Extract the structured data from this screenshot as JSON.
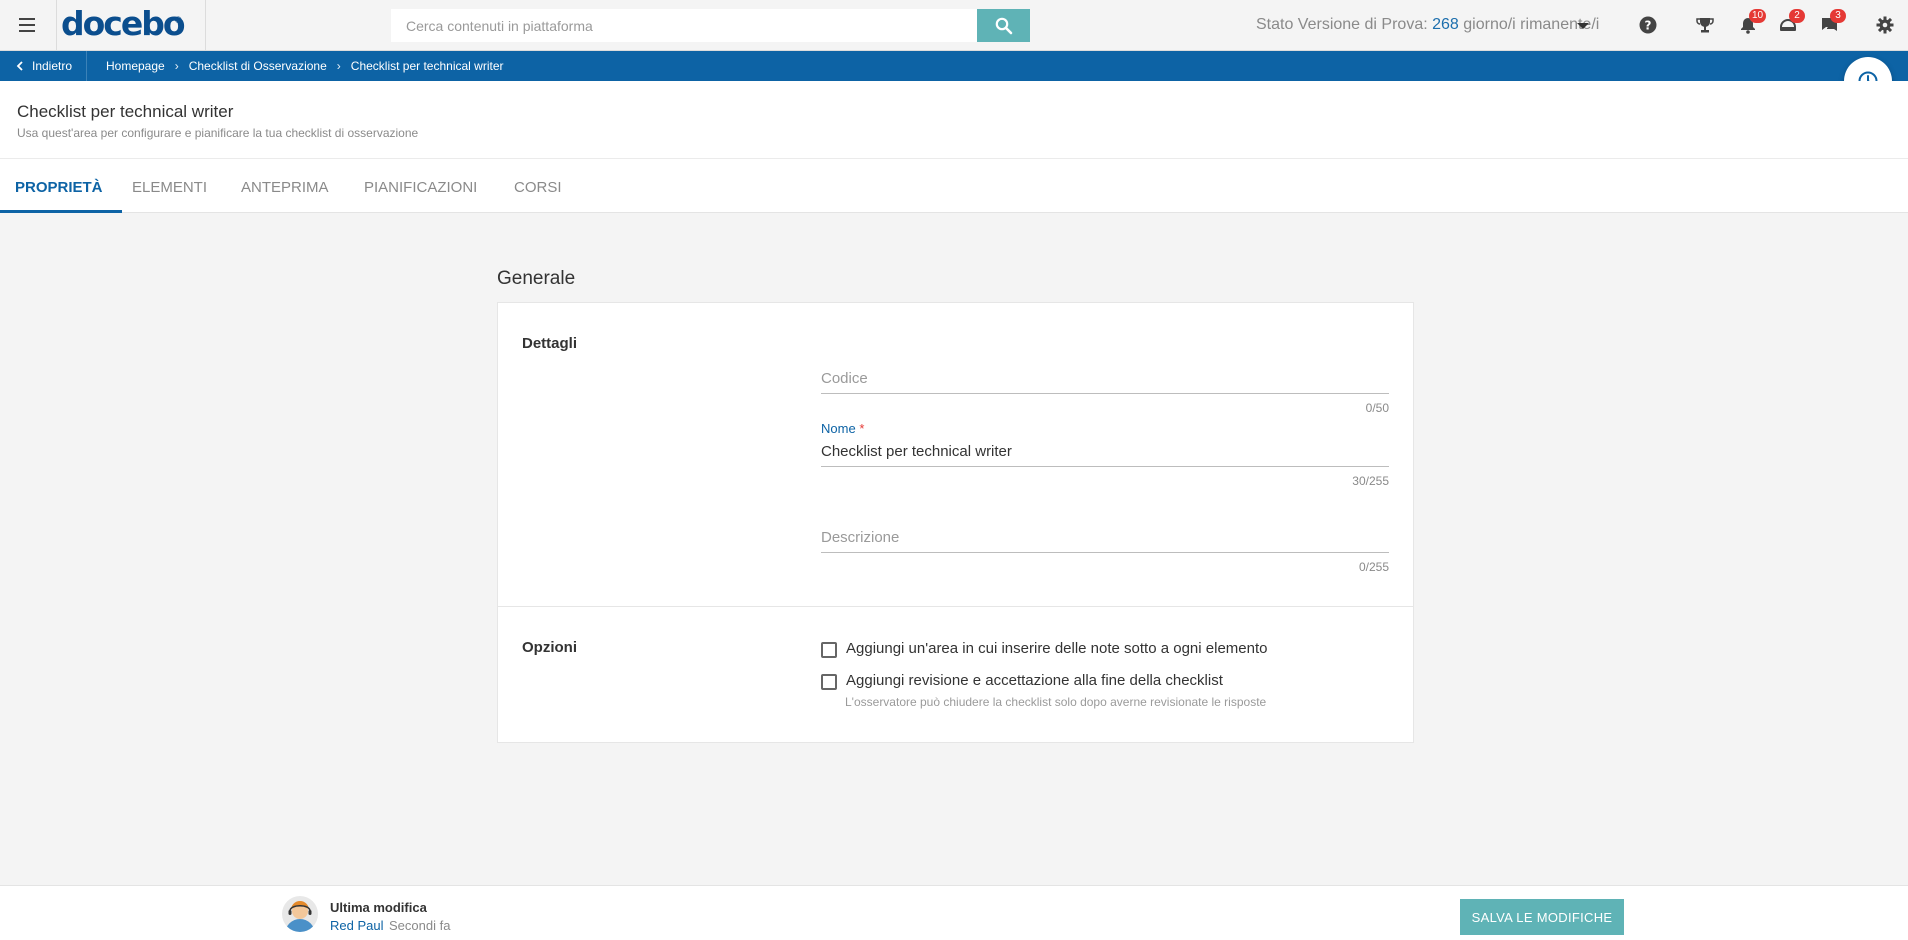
{
  "header": {
    "logo_text": "docebo",
    "logo_mark": "®",
    "search": {
      "placeholder": "Cerca contenuti in piattaforma",
      "value": ""
    },
    "trial": {
      "prefix": "Stato Versione di Prova: ",
      "days": "268",
      "suffix": " giorno/i rimanente/i"
    },
    "badges": {
      "notifications": "10",
      "assignments": "2",
      "messages": "3"
    },
    "icons": [
      "menu-icon",
      "search-icon",
      "help-icon",
      "trophy-icon",
      "bell-icon",
      "coach-icon",
      "chat-icon",
      "gear-icon"
    ]
  },
  "breadcrumb": {
    "back_label": "Indietro",
    "items": [
      "Homepage",
      "Checklist di Osservazione",
      "Checklist per technical writer"
    ]
  },
  "page": {
    "title": "Checklist per technical writer",
    "subtitle": "Usa quest'area per configurare e pianificare la tua checklist di osservazione"
  },
  "tabs": [
    {
      "label": "PROPRIETÀ",
      "active": true
    },
    {
      "label": "ELEMENTI",
      "active": false
    },
    {
      "label": "ANTEPRIMA",
      "active": false
    },
    {
      "label": "PIANIFICAZIONI",
      "active": false
    },
    {
      "label": "CORSI",
      "active": false
    }
  ],
  "general": {
    "section_title": "Generale",
    "details_label": "Dettagli",
    "code": {
      "placeholder": "Codice",
      "value": "",
      "counter": "0/50"
    },
    "name": {
      "label": "Nome",
      "required_mark": "*",
      "value": "Checklist per technical writer",
      "counter": "30/255"
    },
    "description": {
      "placeholder": "Descrizione",
      "value": "",
      "counter": "0/255"
    },
    "options_label": "Opzioni",
    "options": [
      {
        "label": "Aggiungi un'area in cui inserire delle note sotto a ogni elemento",
        "checked": false
      },
      {
        "label": "Aggiungi revisione e accettazione alla fine della checklist",
        "checked": false,
        "hint": "L'osservatore può chiudere la checklist solo dopo averne revisionate le risposte"
      }
    ]
  },
  "footer": {
    "last_modified_label": "Ultima modifica",
    "user": "Red Paul",
    "time": "Secondi fa",
    "save_label": "SALVA LE MODIFICHE"
  },
  "colors": {
    "primary": "#0d63a5",
    "accent": "#5fb3b6",
    "badge": "#e53935"
  }
}
